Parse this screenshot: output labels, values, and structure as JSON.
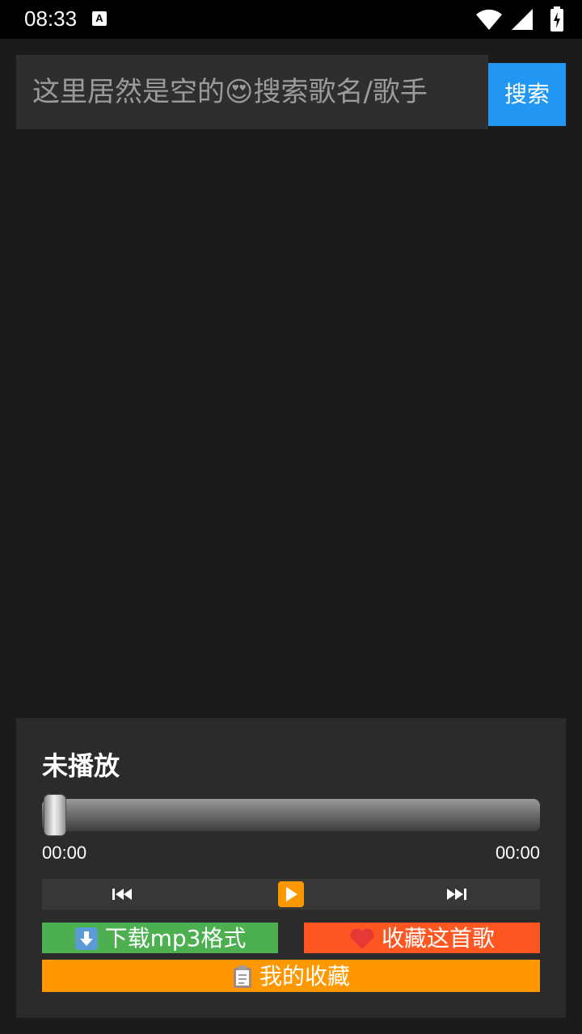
{
  "status_bar": {
    "time": "08:33",
    "a_icon_letter": "A",
    "icons": [
      "keyboard-a-icon",
      "wifi-icon",
      "signal-icon",
      "battery-charging-icon"
    ]
  },
  "search": {
    "placeholder": "这里居然是空的😍搜索歌名/歌手",
    "value": "",
    "button_label": "搜索"
  },
  "player": {
    "track_title": "未播放",
    "current_time": "00:00",
    "duration": "00:00",
    "progress": 0,
    "controls": {
      "prev_icon": "skip-previous-icon",
      "play_icon": "play-icon",
      "next_icon": "skip-next-icon"
    },
    "download_label": "下载mp3格式",
    "favorite_label": "收藏这首歌",
    "my_favorites_label": "我的收藏"
  },
  "colors": {
    "background": "#1b1b1b",
    "search_button": "#2196f3",
    "download_button": "#4caf50",
    "favorite_button": "#ff5722",
    "my_favorites_button": "#ff9800"
  }
}
